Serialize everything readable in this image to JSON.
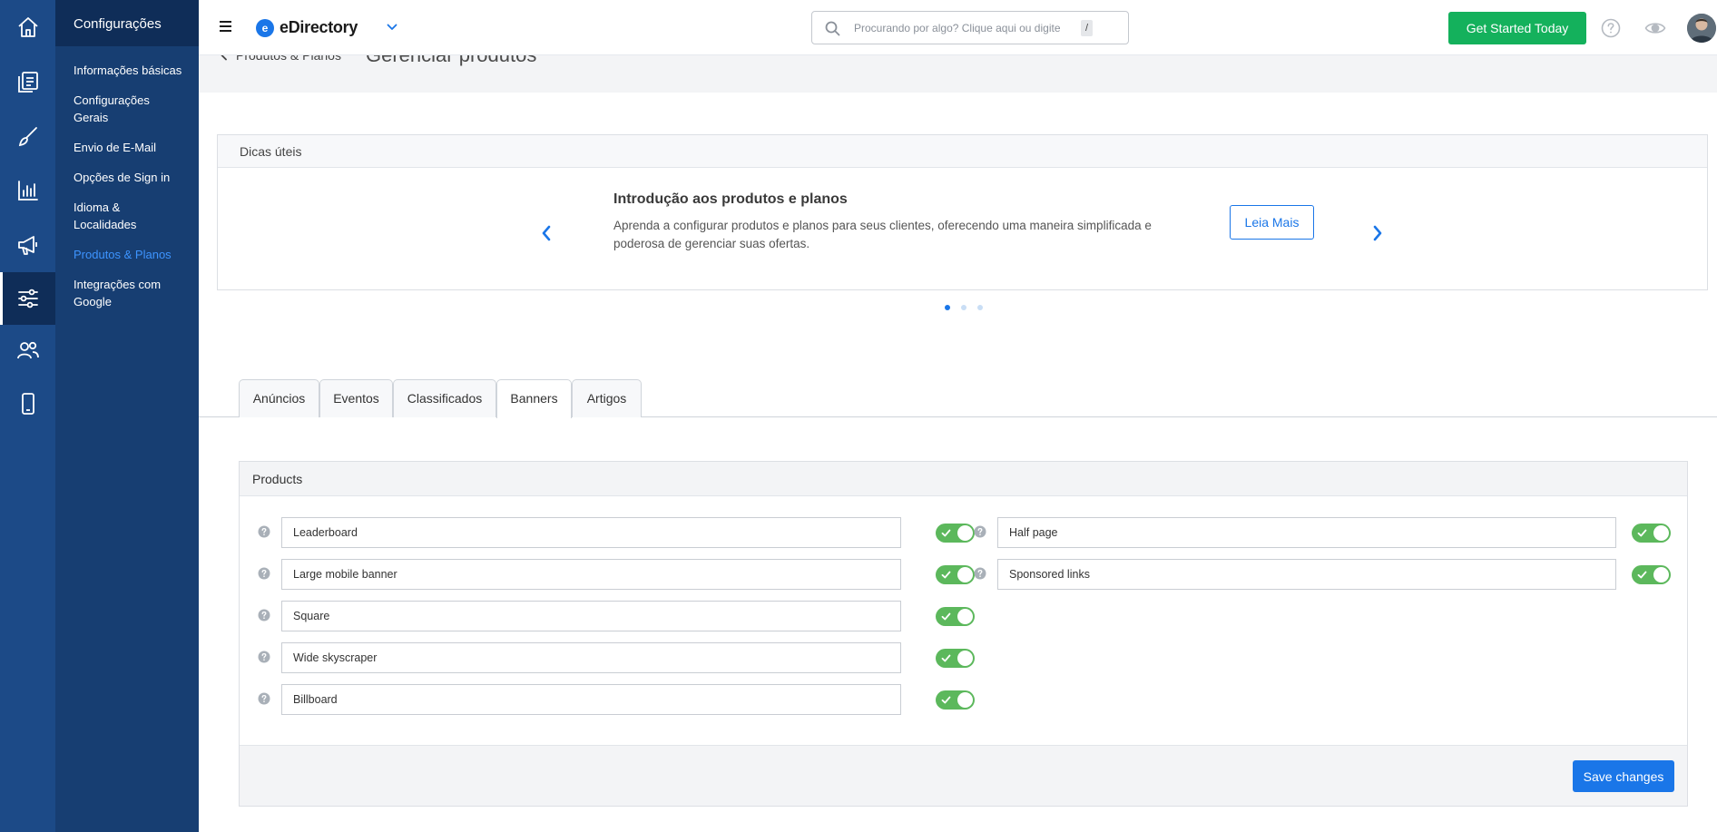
{
  "app": {
    "brand_name": "eDirectory",
    "brand_logo_letter": "e",
    "accent_color": "#1a76e8",
    "cta_color": "#14b15c"
  },
  "rail": {
    "items": [
      {
        "icon": "home-icon"
      },
      {
        "icon": "content-icon"
      },
      {
        "icon": "design-brush-icon"
      },
      {
        "icon": "reports-chart-icon"
      },
      {
        "icon": "megaphone-icon"
      },
      {
        "icon": "settings-sliders-icon",
        "active": true
      },
      {
        "icon": "users-icon"
      },
      {
        "icon": "mobile-icon"
      }
    ]
  },
  "subnav": {
    "title": "Configurações",
    "items": [
      {
        "label": "Informações básicas"
      },
      {
        "label": "Configurações Gerais"
      },
      {
        "label": "Envio de E-Mail"
      },
      {
        "label": "Opções de Sign in"
      },
      {
        "label": "Idioma & Localidades"
      },
      {
        "label": "Produtos & Planos",
        "active": true
      },
      {
        "label": "Integrações com Google"
      }
    ]
  },
  "topbar": {
    "search_placeholder": "Procurando por algo? Clique aqui ou digite",
    "search_shortcut": "/",
    "cta_label": "Get Started Today"
  },
  "page": {
    "breadcrumb": "Produtos & Planos",
    "title": "Gerenciar produtos"
  },
  "tips": {
    "header": "Dicas úteis",
    "title": "Introdução aos produtos e planos",
    "text": "Aprenda a configurar produtos e planos para seus clientes, oferecendo uma maneira simplificada e poderosa de gerenciar suas ofertas.",
    "button_label": "Leia Mais",
    "slide_count": 3,
    "active_slide": 1
  },
  "tabs": [
    {
      "label": "Anúncios"
    },
    {
      "label": "Eventos"
    },
    {
      "label": "Classificados"
    },
    {
      "label": "Banners",
      "active": true
    },
    {
      "label": "Artigos"
    }
  ],
  "products": {
    "header": "Products",
    "left": [
      {
        "value": "Leaderboard",
        "enabled": true
      },
      {
        "value": "Large mobile banner",
        "enabled": true
      },
      {
        "value": "Square",
        "enabled": true
      },
      {
        "value": "Wide skyscraper",
        "enabled": true
      },
      {
        "value": "Billboard",
        "enabled": true
      }
    ],
    "right": [
      {
        "value": "Half page",
        "enabled": true
      },
      {
        "value": "Sponsored links",
        "enabled": true
      }
    ],
    "save_label": "Save changes"
  }
}
